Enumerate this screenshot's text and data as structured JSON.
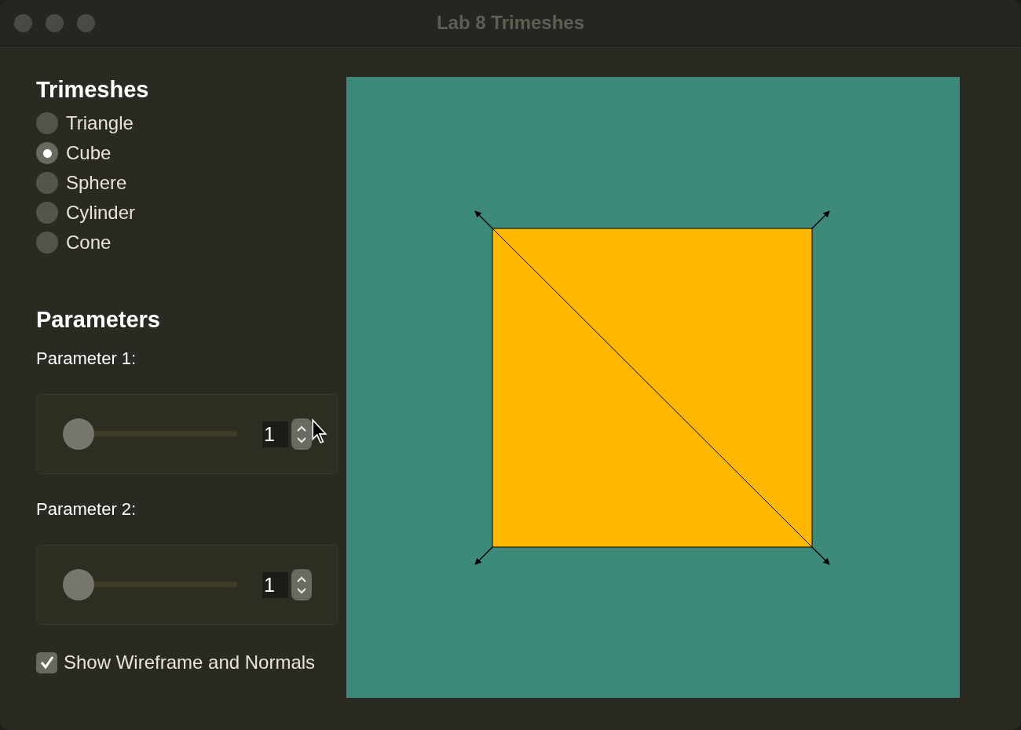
{
  "window": {
    "title": "Lab 8 Trimeshes"
  },
  "trimeshes": {
    "heading": "Trimeshes",
    "options": [
      {
        "label": "Triangle",
        "selected": false
      },
      {
        "label": "Cube",
        "selected": true
      },
      {
        "label": "Sphere",
        "selected": false
      },
      {
        "label": "Cylinder",
        "selected": false
      },
      {
        "label": "Cone",
        "selected": false
      }
    ]
  },
  "parameters": {
    "heading": "Parameters",
    "items": [
      {
        "label": "Parameter 1:",
        "level": 0,
        "value": "1"
      },
      {
        "label": "Parameter 2:",
        "level": 0,
        "value": "1"
      }
    ]
  },
  "show_wireframe": {
    "label": "Show Wireframe and Normals",
    "checked": true
  }
}
